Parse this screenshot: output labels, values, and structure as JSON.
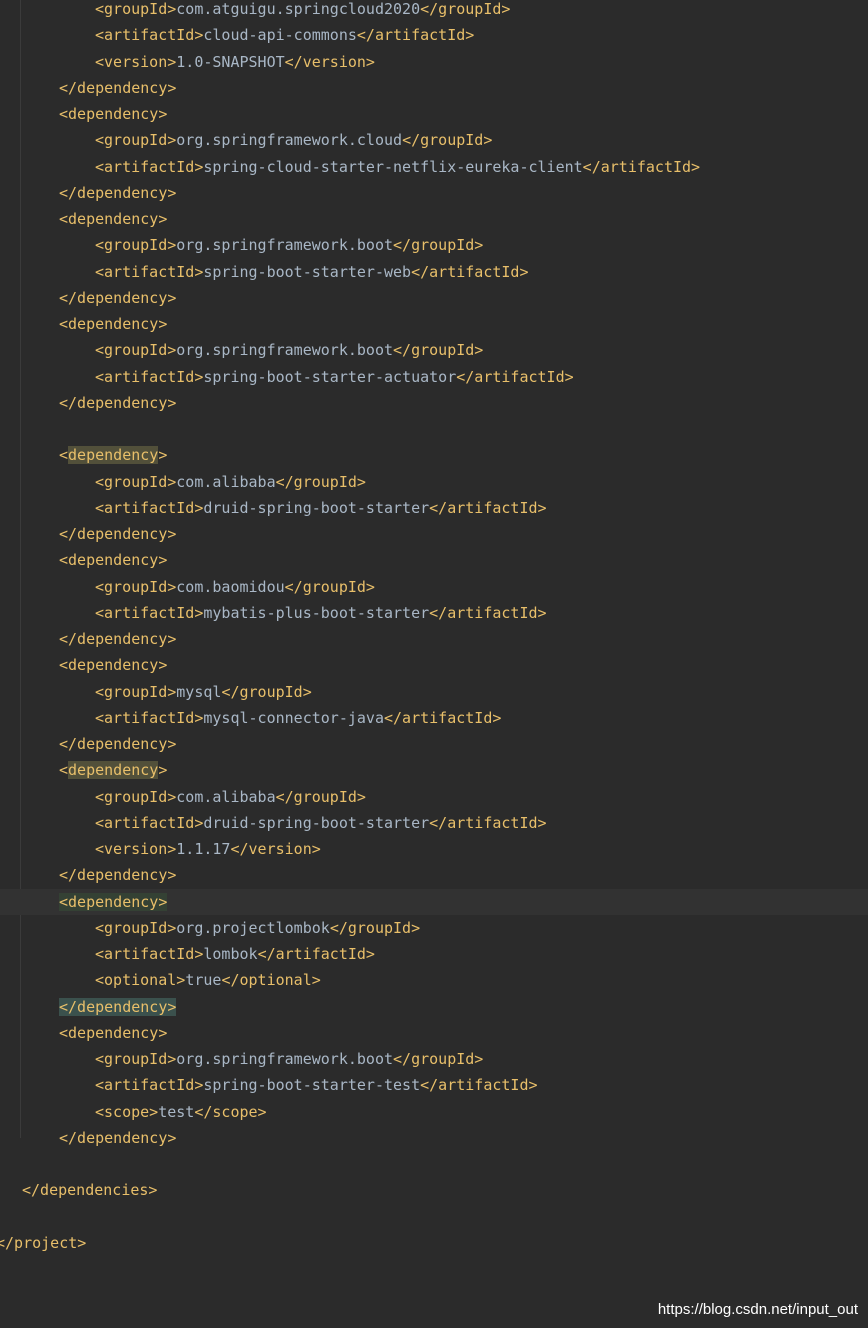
{
  "editor": {
    "lines": [
      {
        "indent": 2,
        "tag": "groupId",
        "text": "com.atguigu.springcloud2020"
      },
      {
        "indent": 2,
        "tag": "artifactId",
        "text": "cloud-api-commons"
      },
      {
        "indent": 2,
        "tag": "version",
        "text": "1.0-SNAPSHOT"
      },
      {
        "indent": 1,
        "close": "dependency"
      },
      {
        "indent": 1,
        "open": "dependency"
      },
      {
        "indent": 2,
        "tag": "groupId",
        "text": "org.springframework.cloud"
      },
      {
        "indent": 2,
        "tag": "artifactId",
        "text": "spring-cloud-starter-netflix-eureka-client"
      },
      {
        "indent": 1,
        "close": "dependency"
      },
      {
        "indent": 1,
        "open": "dependency"
      },
      {
        "indent": 2,
        "tag": "groupId",
        "text": "org.springframework.boot"
      },
      {
        "indent": 2,
        "tag": "artifactId",
        "text": "spring-boot-starter-web"
      },
      {
        "indent": 1,
        "close": "dependency"
      },
      {
        "indent": 1,
        "open": "dependency"
      },
      {
        "indent": 2,
        "tag": "groupId",
        "text": "org.springframework.boot"
      },
      {
        "indent": 2,
        "tag": "artifactId",
        "text": "spring-boot-starter-actuator"
      },
      {
        "indent": 1,
        "close": "dependency"
      },
      {
        "blank": true
      },
      {
        "indent": 1,
        "open": "dependency",
        "highlight": "yellow"
      },
      {
        "indent": 2,
        "tag": "groupId",
        "text": "com.alibaba"
      },
      {
        "indent": 2,
        "tag": "artifactId",
        "text": "druid-spring-boot-starter"
      },
      {
        "indent": 1,
        "close": "dependency"
      },
      {
        "indent": 1,
        "open": "dependency"
      },
      {
        "indent": 2,
        "tag": "groupId",
        "text": "com.baomidou"
      },
      {
        "indent": 2,
        "tag": "artifactId",
        "text": "mybatis-plus-boot-starter"
      },
      {
        "indent": 1,
        "close": "dependency"
      },
      {
        "indent": 1,
        "open": "dependency"
      },
      {
        "indent": 2,
        "tag": "groupId",
        "text": "mysql"
      },
      {
        "indent": 2,
        "tag": "artifactId",
        "text": "mysql-connector-java"
      },
      {
        "indent": 1,
        "close": "dependency"
      },
      {
        "indent": 1,
        "open": "dependency",
        "highlight": "yellow"
      },
      {
        "indent": 2,
        "tag": "groupId",
        "text": "com.alibaba"
      },
      {
        "indent": 2,
        "tag": "artifactId",
        "text": "druid-spring-boot-starter"
      },
      {
        "indent": 2,
        "tag": "version",
        "text": "1.1.17"
      },
      {
        "indent": 1,
        "close": "dependency"
      },
      {
        "indent": 1,
        "open": "dependency",
        "highlight": "green",
        "current": true
      },
      {
        "indent": 2,
        "tag": "groupId",
        "text": "org.projectlombok"
      },
      {
        "indent": 2,
        "tag": "artifactId",
        "text": "lombok"
      },
      {
        "indent": 2,
        "tag": "optional",
        "text": "true"
      },
      {
        "indent": 1,
        "close": "dependency",
        "highlight": "green-strong"
      },
      {
        "indent": 1,
        "open": "dependency"
      },
      {
        "indent": 2,
        "tag": "groupId",
        "text": "org.springframework.boot"
      },
      {
        "indent": 2,
        "tag": "artifactId",
        "text": "spring-boot-starter-test"
      },
      {
        "indent": 2,
        "tag": "scope",
        "text": "test"
      },
      {
        "indent": 1,
        "close": "dependency"
      },
      {
        "blank": true
      },
      {
        "indent": 0,
        "close": "dependencies"
      },
      {
        "blank": true
      },
      {
        "indent": -1,
        "close": "project"
      }
    ]
  },
  "watermark": "https://blog.csdn.net/input_out"
}
